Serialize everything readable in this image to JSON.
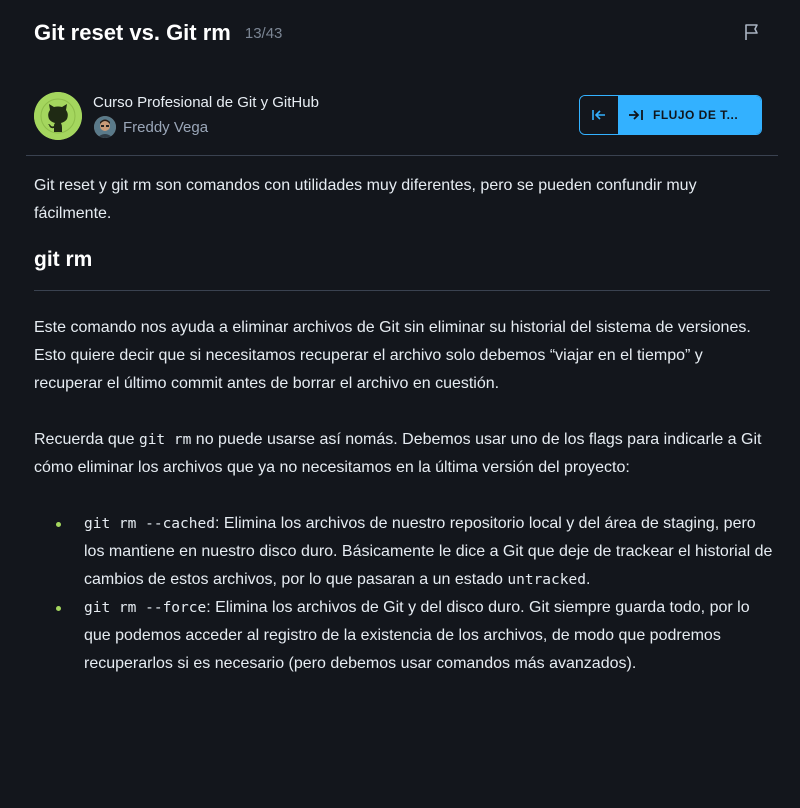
{
  "header": {
    "title": "Git reset vs. Git rm",
    "counter": "13/43"
  },
  "course": {
    "name": "Curso Profesional de Git y GitHub",
    "teacher": "Freddy Vega"
  },
  "route_button": {
    "label": "FLUJO DE T..."
  },
  "content": {
    "intro": "Git reset y git rm son comandos con utilidades muy diferentes, pero se pueden confundir muy fácilmente.",
    "heading": "git rm",
    "para1": "Este comando nos ayuda a eliminar archivos de Git sin eliminar su historial del sistema de versiones. Esto quiere decir que si necesitamos recuperar el archivo solo debemos “viajar en el tiempo” y recuperar el último commit antes de borrar el archivo en cuestión.",
    "para2_before": "Recuerda que ",
    "para2_code": "git rm",
    "para2_after": " no puede usarse así nomás. Debemos usar uno de los flags para indicarle a Git cómo eliminar los archivos que ya no necesitamos en la última versión del proyecto:",
    "items": [
      {
        "code": "git rm --cached",
        "text": ": Elimina los archivos de nuestro repositorio local y del área de staging, pero los mantiene en nuestro disco duro. Básicamente le dice a Git que deje de trackear el historial de cambios de estos archivos, por lo que pasaran a un estado ",
        "code2": "untracked",
        "text2": "."
      },
      {
        "code": "git rm --force",
        "text": ": Elimina los archivos de Git y del disco duro. Git siempre guarda todo, por lo que podemos acceder al registro de la existencia de los archivos, de modo que podremos recuperarlos si es necesario (pero debemos usar comandos más avanzados).",
        "code2": "",
        "text2": ""
      }
    ]
  },
  "colors": {
    "background": "#13161c",
    "accent_blue": "#33b1ff",
    "accent_green": "#a4d65e",
    "divider": "#3a4250"
  },
  "icons": {
    "flag": "flag-icon",
    "course": "github-octocat-icon",
    "prev": "arrow-left-bar-icon",
    "next": "arrow-right-bar-icon"
  }
}
